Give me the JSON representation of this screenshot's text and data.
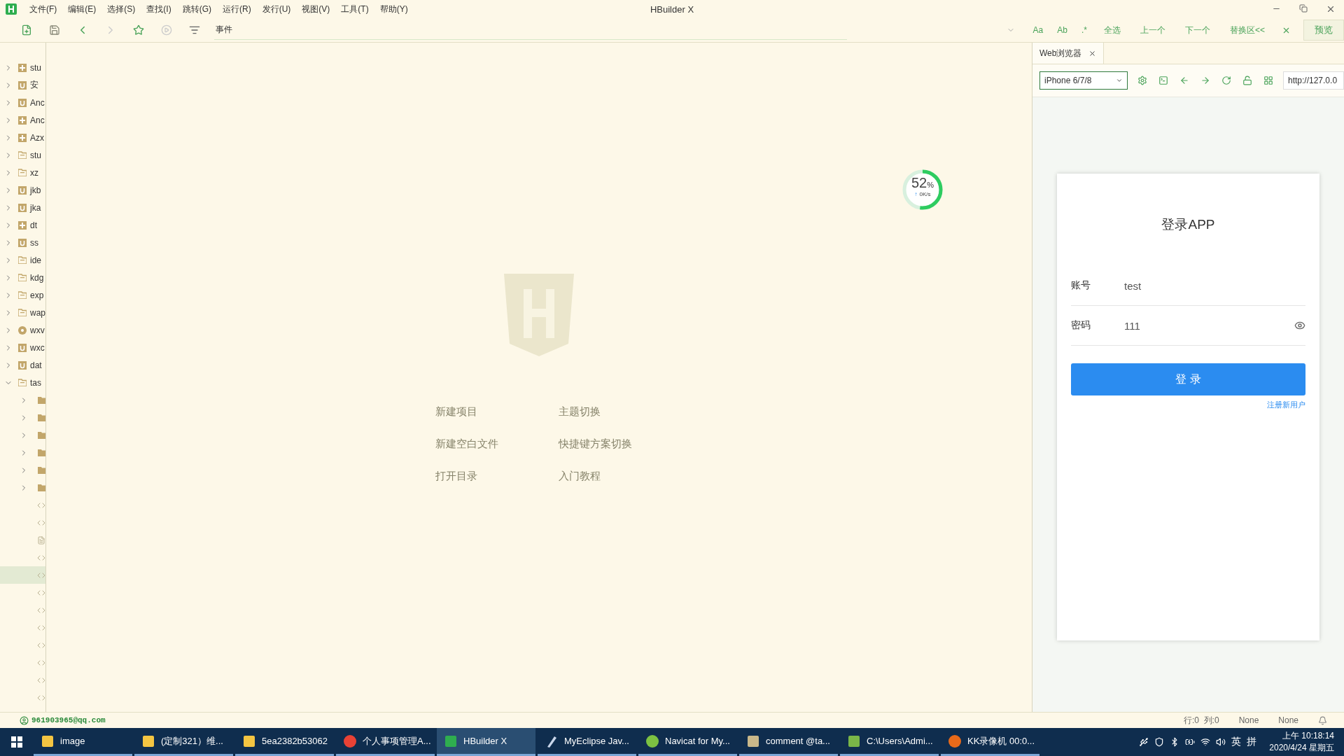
{
  "app": {
    "title": "HBuilder X"
  },
  "menu": [
    "文件(F)",
    "编辑(E)",
    "选择(S)",
    "查找(I)",
    "跳转(G)",
    "运行(R)",
    "发行(U)",
    "视图(V)",
    "工具(T)",
    "帮助(Y)"
  ],
  "toolbar": {
    "search_value": "事件",
    "find_options": [
      "Aa",
      "Ab",
      ".*"
    ],
    "find_actions": [
      "全选",
      "上一个",
      "下一个",
      "替换区<<"
    ],
    "preview": "预览"
  },
  "sidebar": {
    "items": [
      {
        "label": "stu",
        "kind": "five_plus",
        "expanded": false,
        "selected": false
      },
      {
        "label": "安",
        "kind": "uni",
        "expanded": false,
        "selected": false
      },
      {
        "label": "Anc",
        "kind": "uni",
        "expanded": false,
        "selected": false
      },
      {
        "label": "Anc",
        "kind": "five_plus",
        "expanded": false,
        "selected": false
      },
      {
        "label": "Azx",
        "kind": "five_plus",
        "expanded": false,
        "selected": false
      },
      {
        "label": "stu",
        "kind": "folder",
        "expanded": false,
        "selected": false
      },
      {
        "label": "xz",
        "kind": "folder",
        "expanded": false,
        "selected": false
      },
      {
        "label": "jkb",
        "kind": "uni",
        "expanded": false,
        "selected": false
      },
      {
        "label": "jka",
        "kind": "uni",
        "expanded": false,
        "selected": false
      },
      {
        "label": "dt",
        "kind": "five_plus",
        "expanded": false,
        "selected": false
      },
      {
        "label": "ss",
        "kind": "uni",
        "expanded": false,
        "selected": false
      },
      {
        "label": "ide",
        "kind": "folder",
        "expanded": false,
        "selected": false
      },
      {
        "label": "kdg",
        "kind": "folder",
        "expanded": false,
        "selected": false
      },
      {
        "label": "exp",
        "kind": "folder",
        "expanded": false,
        "selected": false
      },
      {
        "label": "wap",
        "kind": "folder",
        "expanded": false,
        "selected": false
      },
      {
        "label": "wxv",
        "kind": "wechat",
        "expanded": false,
        "selected": false
      },
      {
        "label": "wxc",
        "kind": "uni",
        "expanded": false,
        "selected": false
      },
      {
        "label": "dat",
        "kind": "uni",
        "expanded": false,
        "selected": false
      },
      {
        "label": "tas",
        "kind": "folder",
        "expanded": true,
        "selected": false,
        "children": [
          {
            "kind": "dir",
            "expanded": false,
            "selected": false
          },
          {
            "kind": "dir",
            "expanded": false,
            "selected": false
          },
          {
            "kind": "dir",
            "expanded": false,
            "selected": false
          },
          {
            "kind": "dir",
            "expanded": false,
            "selected": false
          },
          {
            "kind": "dir",
            "expanded": false,
            "selected": false
          },
          {
            "kind": "dir",
            "expanded": false,
            "selected": false
          },
          {
            "kind": "code",
            "selected": false
          },
          {
            "kind": "code",
            "selected": false
          },
          {
            "kind": "doc",
            "selected": false
          },
          {
            "kind": "code",
            "selected": false
          },
          {
            "kind": "code",
            "selected": true
          },
          {
            "kind": "code",
            "selected": false
          },
          {
            "kind": "code",
            "selected": false
          },
          {
            "kind": "code",
            "selected": false
          },
          {
            "kind": "code",
            "selected": false
          },
          {
            "kind": "code",
            "selected": false
          },
          {
            "kind": "code",
            "selected": false
          },
          {
            "kind": "code",
            "selected": false
          }
        ]
      }
    ]
  },
  "welcome": {
    "links": [
      "新建项目",
      "主题切换",
      "新建空白文件",
      "快捷键方案切换",
      "打开目录",
      "入门教程"
    ]
  },
  "speed": {
    "percent": "52",
    "unit": "%",
    "arrow": "↑",
    "rate": "0K/s",
    "level": 0.52
  },
  "browser": {
    "tab": {
      "label": "Web浏览器",
      "selected": true
    },
    "device": "iPhone 6/7/8",
    "url": "http://127.0.0",
    "page": {
      "title": "登录APP",
      "fields": [
        {
          "label": "账号",
          "value": "test",
          "kind": "text"
        },
        {
          "label": "密码",
          "value": "111",
          "kind": "password"
        }
      ],
      "button": "登 录",
      "link": "注册新用户"
    }
  },
  "status_bar": {
    "user": "961903965@qq.com",
    "items": [
      "行:0  列:0",
      "None",
      "None"
    ]
  },
  "taskbar": {
    "items": [
      {
        "label": "image",
        "kind": "folder",
        "selected": false
      },
      {
        "label": "(定制321）维...",
        "kind": "folder",
        "selected": false
      },
      {
        "label": "5ea2382b53062",
        "kind": "folder",
        "selected": false
      },
      {
        "label": "个人事项管理A...",
        "kind": "chrome",
        "selected": false
      },
      {
        "label": "HBuilder X",
        "kind": "hbuilder",
        "selected": true
      },
      {
        "label": "MyEclipse Jav...",
        "kind": "eclipse",
        "selected": false
      },
      {
        "label": "Navicat for My...",
        "kind": "navicat",
        "selected": false
      },
      {
        "label": "comment @ta...",
        "kind": "comment",
        "selected": false
      },
      {
        "label": "C:\\Users\\Admi...",
        "kind": "notepad",
        "selected": false
      },
      {
        "label": "KK录像机 00:0...",
        "kind": "kk",
        "selected": false
      }
    ],
    "ime": [
      "英",
      "拼"
    ],
    "time": "上午 10:18:14",
    "date": "2020/4/24 星期五"
  }
}
